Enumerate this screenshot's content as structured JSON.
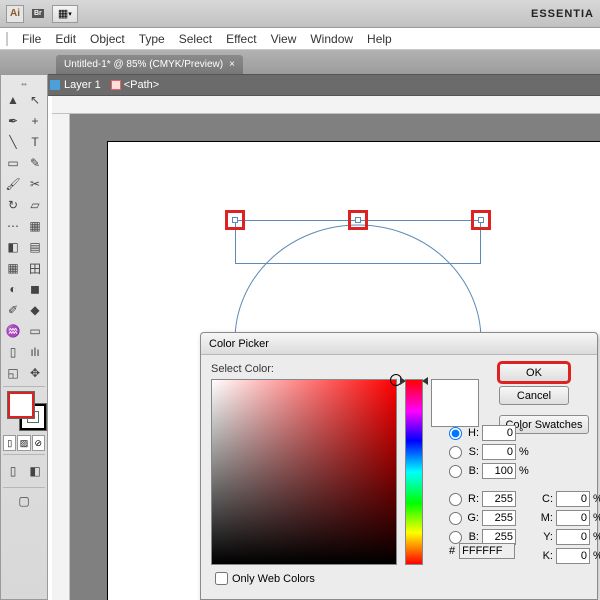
{
  "titlebar": {
    "logo": "Ai",
    "br": "Br",
    "workspace": "ESSENTIA"
  },
  "menu": {
    "items": [
      "File",
      "Edit",
      "Object",
      "Type",
      "Select",
      "Effect",
      "View",
      "Window",
      "Help"
    ]
  },
  "tab": {
    "label": "Untitled-1* @ 85% (CMYK/Preview)",
    "close": "×"
  },
  "layerbar": {
    "back": "◀",
    "fwd": "▶",
    "layer": "Layer 1",
    "path": "<Path>"
  },
  "tools": {
    "r1a": "▲",
    "r1b": "↖",
    "r2a": "✒",
    "r2b": "+",
    "r3a": "╲",
    "r3b": "T",
    "r4a": "▭",
    "r4b": "✎",
    "r5a": "🖌",
    "r5b": "✂",
    "r6a": "↻",
    "r6b": "▱",
    "r7a": "⋯",
    "r7b": "▦",
    "r8a": "◧",
    "r8b": "▤",
    "r9a": "▦",
    "r9b": "田",
    "r10a": "◐",
    "r10b": "◼",
    "r11a": "✐",
    "r11b": "◆",
    "r12a": "♒",
    "r12b": "▭",
    "r13a": "▯",
    "r13b": "ılı",
    "r14a": "◱",
    "r14b": "✥",
    "r15a": "🔍",
    "r15b": "",
    "m1": "▯",
    "m2": "▨",
    "m3": "⊘"
  },
  "picker": {
    "title": "Color Picker",
    "select": "Select Color:",
    "ok": "OK",
    "cancel": "Cancel",
    "swatches": "Color Swatches",
    "owc": "Only Web Colors",
    "H": "0",
    "S": "0",
    "B": "100",
    "R": "255",
    "G": "255",
    "Bb": "255",
    "C": "0",
    "M": "0",
    "Y": "0",
    "K": "0",
    "hex": "FFFFFF",
    "deg": "°",
    "pct": "%",
    "hash": "#",
    "lH": "H:",
    "lS": "S:",
    "lB": "B:",
    "lR": "R:",
    "lG": "G:",
    "lBb": "B:",
    "lC": "C:",
    "lM": "M:",
    "lY": "Y:",
    "lK": "K:"
  }
}
